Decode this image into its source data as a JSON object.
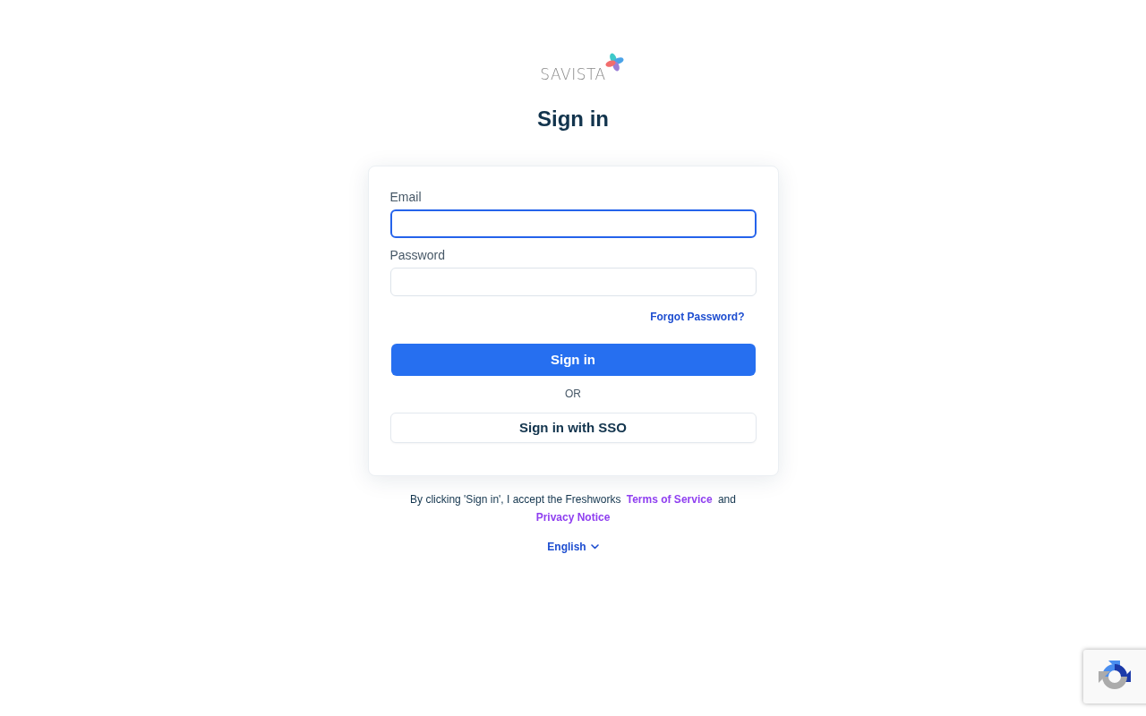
{
  "logo": {
    "text": "SAVISTA"
  },
  "heading": "Sign in",
  "form": {
    "fields": [
      {
        "label": "Email",
        "focused": true
      },
      {
        "label": "Password",
        "focused": false
      }
    ],
    "forgot_link": "Forgot Password?",
    "primary_button": "Sign in",
    "divider": "OR",
    "sso_button": "Sign in with SSO"
  },
  "consent": {
    "text_before": "By clicking 'Sign in', I accept the Freshworks",
    "terms_link": "Terms of Service",
    "conjunction": "and",
    "privacy_link": "Privacy Notice"
  },
  "language": {
    "label": "English"
  }
}
